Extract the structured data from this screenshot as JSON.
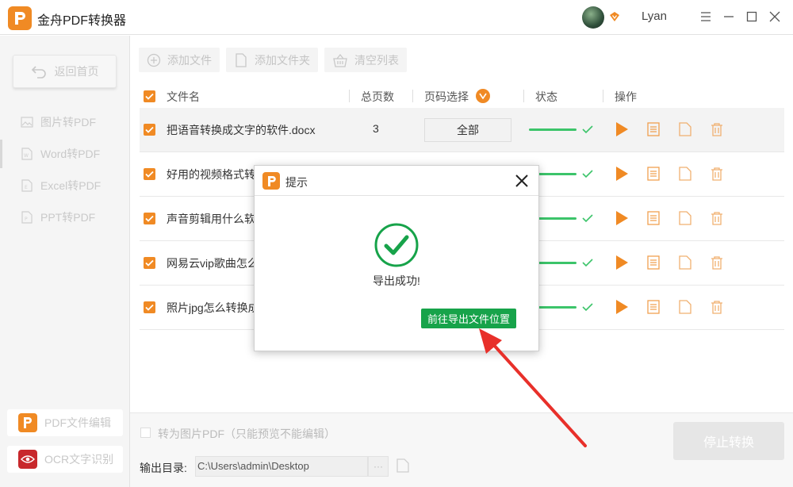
{
  "app": {
    "title": "金舟PDF转换器",
    "username": "Lyan"
  },
  "sidebar": {
    "back_label": "返回首页",
    "items": [
      {
        "label": "图片转PDF",
        "icon": "image-icon"
      },
      {
        "label": "Word转PDF",
        "icon": "word-icon"
      },
      {
        "label": "Excel转PDF",
        "icon": "excel-icon"
      },
      {
        "label": "PPT转PDF",
        "icon": "ppt-icon"
      }
    ],
    "bottom": [
      {
        "label": "PDF文件编辑",
        "icon": "pdf-edit-icon"
      },
      {
        "label": "OCR文字识别",
        "icon": "ocr-eye-icon"
      }
    ]
  },
  "toolbar": {
    "add_file": "添加文件",
    "add_folder": "添加文件夹",
    "clear_list": "清空列表"
  },
  "table": {
    "headers": {
      "name": "文件名",
      "pages": "总页数",
      "page_select": "页码选择",
      "status": "状态",
      "actions": "操作"
    },
    "rows": [
      {
        "name": "把语音转换成文字的软件.docx",
        "pages": "3",
        "page_select": "全部"
      },
      {
        "name": "好用的视频格式转",
        "pages": "",
        "page_select": ""
      },
      {
        "name": "声音剪辑用什么软",
        "pages": "",
        "page_select": ""
      },
      {
        "name": "网易云vip歌曲怎么",
        "pages": "",
        "page_select": ""
      },
      {
        "name": "照片jpg怎么转换成",
        "pages": "",
        "page_select": ""
      }
    ]
  },
  "footer": {
    "image_pdf_label": "转为图片PDF（只能预览不能编辑）",
    "output_label": "输出目录:",
    "output_path": "C:\\Users\\admin\\Desktop",
    "more": "···",
    "stop_label": "停止转换"
  },
  "dialog": {
    "title": "提示",
    "message": "导出成功!",
    "button": "前往导出文件位置"
  },
  "colors": {
    "accent": "#f08a24",
    "success": "#17a34a",
    "progress": "#3cc46a",
    "annotation": "#e8302a"
  }
}
